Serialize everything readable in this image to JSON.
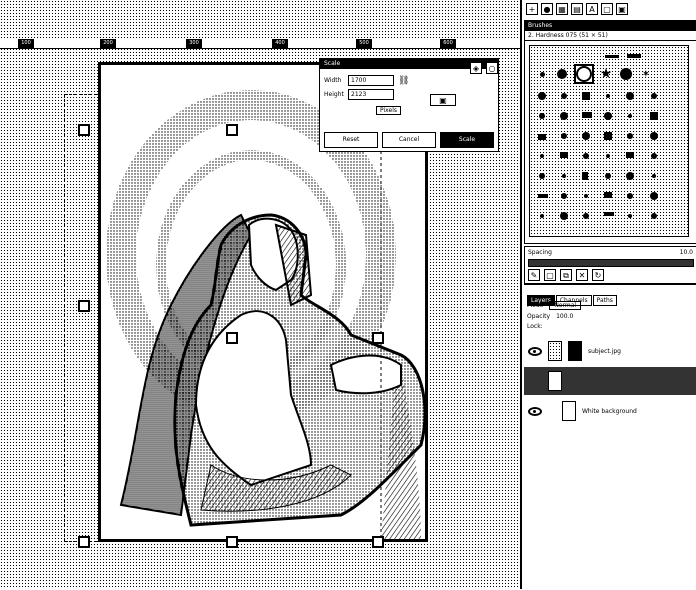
{
  "canvas": {
    "ruler_labels": [
      "100",
      "200",
      "300",
      "400",
      "500",
      "600"
    ]
  },
  "scale_dialog": {
    "title": "Scale",
    "width_label": "Width",
    "width_value": "1700",
    "height_label": "Height",
    "height_value": "2123",
    "units_label": "Pixels",
    "reset_label": "Reset",
    "cancel_label": "Cancel",
    "scale_label": "Scale"
  },
  "panel": {
    "brushes_title": "Brushes",
    "brushes_subtitle": "2. Hardness 075 (51 × 51)",
    "spacing_label": "Spacing",
    "spacing_value": "10.0",
    "tabs": [
      "Layers",
      "Channels",
      "Paths"
    ],
    "mode_label": "Mode",
    "mode_value": "Normal",
    "opacity_label": "Opacity",
    "opacity_value": "100.0",
    "lock_label": "Lock:",
    "layers": [
      {
        "name": "subject.jpg",
        "selected": false
      },
      {
        "name": "",
        "selected": true
      },
      {
        "name": "White background",
        "selected": false
      }
    ]
  },
  "colors": {
    "ink": "#000000",
    "paper": "#ffffff"
  }
}
